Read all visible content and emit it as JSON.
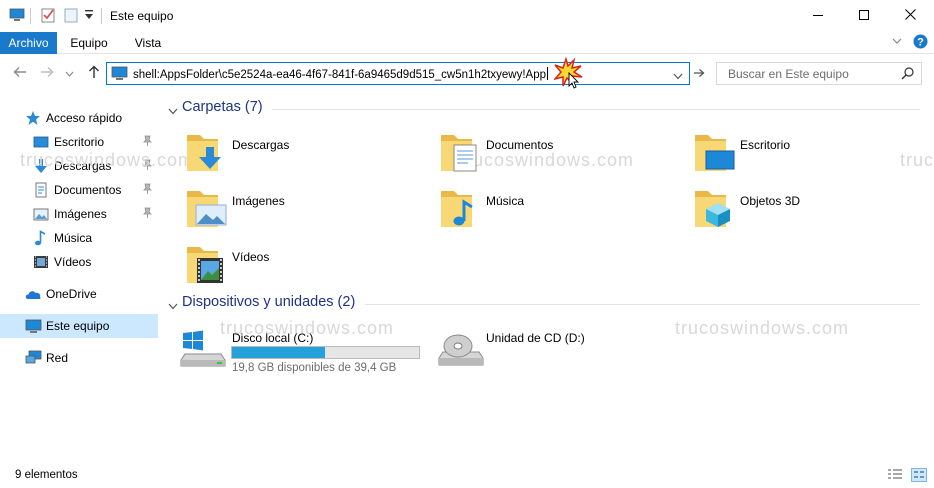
{
  "window": {
    "title": "Este equipo",
    "minimize_icon": "minimize-icon",
    "maximize_icon": "maximize-icon",
    "close_icon": "close-icon"
  },
  "ribbon": {
    "tabs": [
      {
        "label": "Archivo",
        "active": true
      },
      {
        "label": "Equipo",
        "active": false
      },
      {
        "label": "Vista",
        "active": false
      }
    ]
  },
  "navigation": {
    "address_value": "shell:AppsFolder\\c5e2524a-ea46-4f67-841f-6a9465d9d515_cw5n1h2txyewy!App",
    "search_placeholder": "Buscar en Este equipo"
  },
  "sidebar": {
    "items": [
      {
        "label": "Acceso rápido",
        "icon": "star-icon"
      },
      {
        "label": "Escritorio",
        "icon": "desktop-icon",
        "pinned": true
      },
      {
        "label": "Descargas",
        "icon": "download-icon",
        "pinned": true
      },
      {
        "label": "Documentos",
        "icon": "document-icon",
        "pinned": true
      },
      {
        "label": "Imágenes",
        "icon": "pictures-icon",
        "pinned": true
      },
      {
        "label": "Música",
        "icon": "music-icon"
      },
      {
        "label": "Vídeos",
        "icon": "video-icon"
      },
      {
        "label": "OneDrive",
        "icon": "cloud-icon"
      },
      {
        "label": "Este equipo",
        "icon": "computer-icon",
        "selected": true
      },
      {
        "label": "Red",
        "icon": "network-icon"
      }
    ]
  },
  "main": {
    "folders_header": "Carpetas (7)",
    "folders": [
      {
        "label": "Descargas",
        "icon": "downloads-folder-icon"
      },
      {
        "label": "Documentos",
        "icon": "documents-folder-icon"
      },
      {
        "label": "Escritorio",
        "icon": "desktop-folder-icon"
      },
      {
        "label": "Imágenes",
        "icon": "pictures-folder-icon"
      },
      {
        "label": "Música",
        "icon": "music-folder-icon"
      },
      {
        "label": "Objetos 3D",
        "icon": "3d-objects-folder-icon"
      },
      {
        "label": "Vídeos",
        "icon": "videos-folder-icon"
      }
    ],
    "devices_header": "Dispositivos y unidades (2)",
    "devices": [
      {
        "label": "Disco local (C:)",
        "free_text": "19,8 GB disponibles de 39,4 GB",
        "used_fraction": 0.497,
        "icon": "local-disk-icon"
      },
      {
        "label": "Unidad de CD (D:)",
        "icon": "cd-drive-icon"
      }
    ],
    "watermark": "trucoswindows.com"
  },
  "status": {
    "item_count": "9 elementos"
  },
  "colors": {
    "accent": "#1979ca",
    "selection": "#cce8ff",
    "group_header": "#1e3287",
    "drive_bar": "#26a0da",
    "folder_yellow": "#f8d775"
  }
}
